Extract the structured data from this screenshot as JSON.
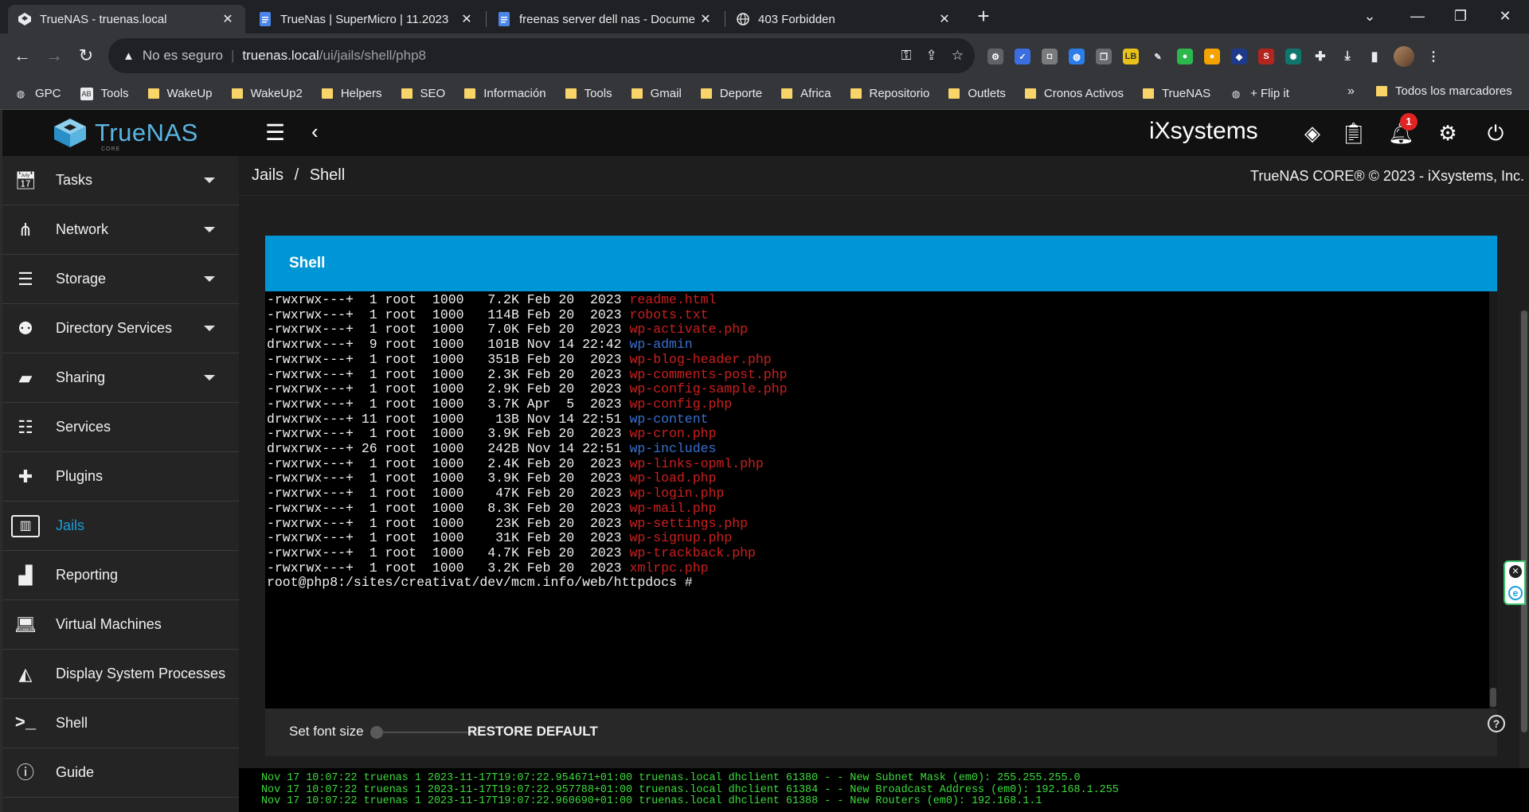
{
  "browser": {
    "tabs": [
      {
        "title": "TrueNAS - truenas.local",
        "icon": "truenas-icon"
      },
      {
        "title": "TrueNas | SuperMicro | 11.2023",
        "icon": "docs-icon"
      },
      {
        "title": "freenas server dell nas - Docume",
        "icon": "docs-icon"
      },
      {
        "title": "403 Forbidden",
        "icon": "globe-icon"
      }
    ],
    "address": {
      "security_label": "No es seguro",
      "host": "truenas.local",
      "path": "/ui/jails/shell/php8"
    },
    "bookmarks": [
      {
        "label": "GPC",
        "icon": "globe-icon"
      },
      {
        "label": "Tools",
        "icon": "app-icon"
      },
      {
        "label": "WakeUp",
        "icon": "folder-icon"
      },
      {
        "label": "WakeUp2",
        "icon": "folder-icon"
      },
      {
        "label": "Helpers",
        "icon": "folder-icon"
      },
      {
        "label": "SEO",
        "icon": "folder-icon"
      },
      {
        "label": "Información",
        "icon": "folder-icon"
      },
      {
        "label": "Tools",
        "icon": "folder-icon"
      },
      {
        "label": "Gmail",
        "icon": "folder-icon"
      },
      {
        "label": "Deporte",
        "icon": "folder-icon"
      },
      {
        "label": "Africa",
        "icon": "folder-icon"
      },
      {
        "label": "Repositorio",
        "icon": "folder-icon"
      },
      {
        "label": "Outlets",
        "icon": "folder-icon"
      },
      {
        "label": "Cronos Activos",
        "icon": "folder-icon"
      },
      {
        "label": "TrueNAS",
        "icon": "folder-icon"
      },
      {
        "label": "+ Flip it",
        "icon": "globe-icon"
      }
    ],
    "all_bookmarks_label": "Todos los marcadores"
  },
  "app": {
    "logo_text": "TrueNAS",
    "logo_sub": "CORE",
    "vendor_logo": "iXsystems",
    "notification_count": "1",
    "copyright": "TrueNAS CORE® © 2023 - iXsystems, Inc.",
    "breadcrumb": {
      "parent": "Jails",
      "separator": "/",
      "current": "Shell"
    },
    "sidebar": [
      {
        "label": "Tasks",
        "icon": "calendar-icon",
        "expandable": true
      },
      {
        "label": "Network",
        "icon": "network-icon",
        "expandable": true
      },
      {
        "label": "Storage",
        "icon": "storage-icon",
        "expandable": true
      },
      {
        "label": "Directory Services",
        "icon": "directory-services-icon",
        "expandable": true
      },
      {
        "label": "Sharing",
        "icon": "sharing-folder-icon",
        "expandable": true
      },
      {
        "label": "Services",
        "icon": "sliders-icon",
        "expandable": false
      },
      {
        "label": "Plugins",
        "icon": "puzzle-icon",
        "expandable": false
      },
      {
        "label": "Jails",
        "icon": "jail-icon",
        "expandable": false,
        "active": true
      },
      {
        "label": "Reporting",
        "icon": "chart-icon",
        "expandable": false
      },
      {
        "label": "Virtual Machines",
        "icon": "laptop-icon",
        "expandable": false
      },
      {
        "label": "Display System Processes",
        "icon": "processes-icon",
        "expandable": false
      },
      {
        "label": "Shell",
        "icon": "terminal-icon",
        "expandable": false
      },
      {
        "label": "Guide",
        "icon": "info-icon",
        "expandable": false
      }
    ],
    "shell": {
      "title": "Shell",
      "lines": [
        {
          "meta": "-rwxrwx---+  1 root  1000   7.2K Feb 20  2023 ",
          "name": "readme.html",
          "type": "file"
        },
        {
          "meta": "-rwxrwx---+  1 root  1000   114B Feb 20  2023 ",
          "name": "robots.txt",
          "type": "file"
        },
        {
          "meta": "-rwxrwx---+  1 root  1000   7.0K Feb 20  2023 ",
          "name": "wp-activate.php",
          "type": "file"
        },
        {
          "meta": "drwxrwx---+  9 root  1000   101B Nov 14 22:42 ",
          "name": "wp-admin",
          "type": "dir"
        },
        {
          "meta": "-rwxrwx---+  1 root  1000   351B Feb 20  2023 ",
          "name": "wp-blog-header.php",
          "type": "file"
        },
        {
          "meta": "-rwxrwx---+  1 root  1000   2.3K Feb 20  2023 ",
          "name": "wp-comments-post.php",
          "type": "file"
        },
        {
          "meta": "-rwxrwx---+  1 root  1000   2.9K Feb 20  2023 ",
          "name": "wp-config-sample.php",
          "type": "file"
        },
        {
          "meta": "-rwxrwx---+  1 root  1000   3.7K Apr  5  2023 ",
          "name": "wp-config.php",
          "type": "file"
        },
        {
          "meta": "drwxrwx---+ 11 root  1000    13B Nov 14 22:51 ",
          "name": "wp-content",
          "type": "dir"
        },
        {
          "meta": "-rwxrwx---+  1 root  1000   3.9K Feb 20  2023 ",
          "name": "wp-cron.php",
          "type": "file"
        },
        {
          "meta": "drwxrwx---+ 26 root  1000   242B Nov 14 22:51 ",
          "name": "wp-includes",
          "type": "dir"
        },
        {
          "meta": "-rwxrwx---+  1 root  1000   2.4K Feb 20  2023 ",
          "name": "wp-links-opml.php",
          "type": "file"
        },
        {
          "meta": "-rwxrwx---+  1 root  1000   3.9K Feb 20  2023 ",
          "name": "wp-load.php",
          "type": "file"
        },
        {
          "meta": "-rwxrwx---+  1 root  1000    47K Feb 20  2023 ",
          "name": "wp-login.php",
          "type": "file"
        },
        {
          "meta": "-rwxrwx---+  1 root  1000   8.3K Feb 20  2023 ",
          "name": "wp-mail.php",
          "type": "file"
        },
        {
          "meta": "-rwxrwx---+  1 root  1000    23K Feb 20  2023 ",
          "name": "wp-settings.php",
          "type": "file"
        },
        {
          "meta": "-rwxrwx---+  1 root  1000    31K Feb 20  2023 ",
          "name": "wp-signup.php",
          "type": "file"
        },
        {
          "meta": "-rwxrwx---+  1 root  1000   4.7K Feb 20  2023 ",
          "name": "wp-trackback.php",
          "type": "file"
        },
        {
          "meta": "-rwxrwx---+  1 root  1000   3.2K Feb 20  2023 ",
          "name": "xmlrpc.php",
          "type": "file"
        }
      ],
      "prompt": "root@php8:/sites/creativat/dev/mcm.info/web/httpdocs # ",
      "font_size_label": "Set font size",
      "restore_label": "RESTORE DEFAULT"
    },
    "console": [
      "Nov 17 10:07:22 truenas 1 2023-11-17T19:07:22.954671+01:00 truenas.local dhclient 61380 - - New Subnet Mask (em0): 255.255.255.0",
      "Nov 17 10:07:22 truenas 1 2023-11-17T19:07:22.957788+01:00 truenas.local dhclient 61384 - - New Broadcast Address (em0): 192.168.1.255",
      "Nov 17 10:07:22 truenas 1 2023-11-17T19:07:22.960690+01:00 truenas.local dhclient 61388 - - New Routers (em0): 192.168.1.1"
    ]
  },
  "colors": {
    "accent": "#0095d5",
    "active_nav": "#1a9ddb",
    "file_name": "#cc1f1f",
    "dir_name": "#3a6fd0",
    "console_text": "#3ddb3d"
  }
}
